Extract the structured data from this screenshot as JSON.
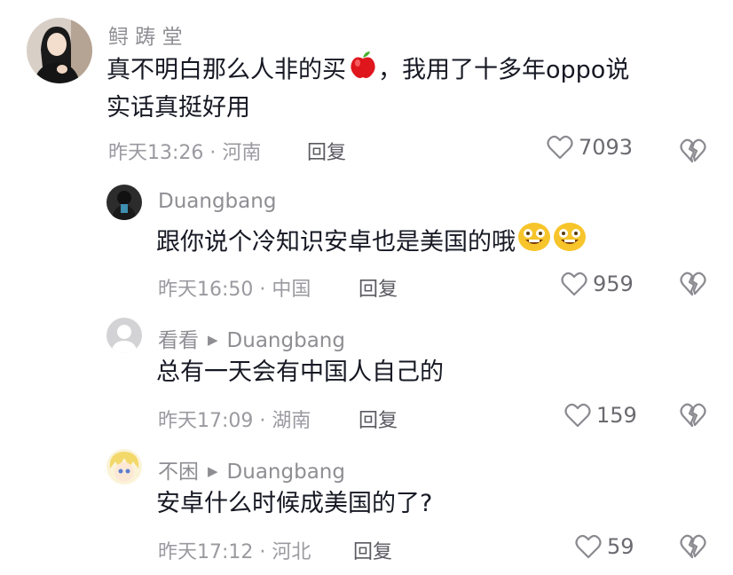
{
  "comments": [
    {
      "author": "鲟 踌 堂",
      "text_line1": "真不明白那么人非的买",
      "text_line1_tail": "，我用了十多年oppo说",
      "text_line2": "实话真挺好用",
      "meta": "昨天13:26 · 河南",
      "reply_label": "回复",
      "likes": "7093"
    },
    {
      "author": "Duangbang",
      "text": "跟你说个冷知识安卓也是美国的哦",
      "meta": "昨天16:50 · 中国",
      "reply_label": "回复",
      "likes": "959"
    },
    {
      "author": "看看",
      "reply_to": "Duangbang",
      "text": "总有一天会有中国人自己的",
      "meta": "昨天17:09 · 湖南",
      "reply_label": "回复",
      "likes": "159"
    },
    {
      "author": "不困",
      "reply_to": "Duangbang",
      "text": "安卓什么时候成美国的了?",
      "meta": "昨天17:12 · 河北",
      "reply_label": "回复",
      "likes": "59"
    }
  ],
  "icons": {
    "apple_emoji": "red-apple-icon",
    "grin_emoji": "grinning-face-icon",
    "like": "heart-outline-icon",
    "dislike": "broken-heart-icon",
    "reply_arrow": "triangle-right-icon"
  }
}
